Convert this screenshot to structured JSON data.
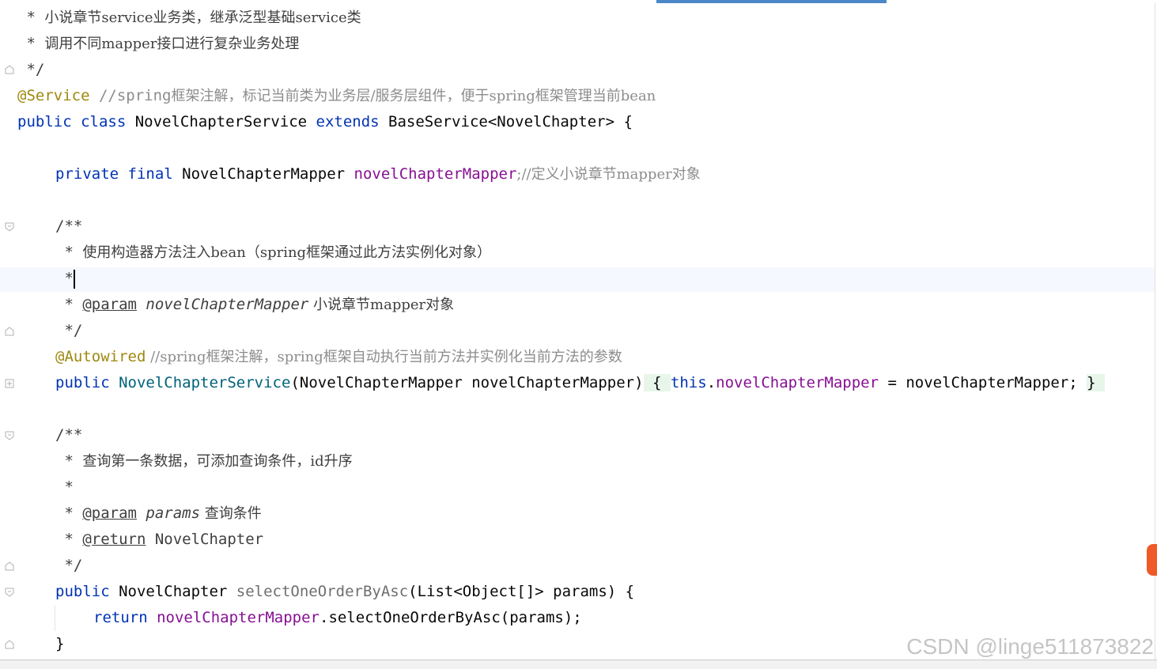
{
  "code_lines": {
    "l1": {
      "prefix": " * ",
      "text": "小说章节service业务类，继承泛型基础service类"
    },
    "l2": {
      "prefix": " * ",
      "text": "调用不同mapper接口进行复杂业务处理"
    },
    "l3": {
      "text": " */"
    },
    "l4": {
      "annotation": "@Service",
      "comment_prefix": " //spring",
      "comment_text": "框架注解，标记当前类为业务层/服务层组件，便于spring框架管理当前bean"
    },
    "l5": {
      "kw1": "public",
      "kw2": "class",
      "class_name": " NovelChapterService ",
      "kw3": "extends",
      "rest": " BaseService<NovelChapter> {"
    },
    "l7": {
      "kw1": "private",
      "kw2": "final",
      "type": " NovelChapterMapper ",
      "field": "novelChapterMapper",
      "comment": ";//定义小说章节mapper对象"
    },
    "l9": {
      "text": "/**"
    },
    "l10": {
      "prefix": " * ",
      "text": "使用构造器方法注入bean（spring框架通过此方法实例化对象）"
    },
    "l11": {
      "text": " *"
    },
    "l12": {
      "prefix": " * ",
      "tag": "@param",
      "param": "novelChapterMapper",
      "text": " 小说章节mapper对象"
    },
    "l13": {
      "text": " */"
    },
    "l14": {
      "annotation": "@Autowired",
      "comment": " //spring框架注解，spring框架自动执行当前方法并实例化当前方法的参数"
    },
    "l15": {
      "kw1": "public",
      "ctor": "NovelChapterService",
      "params": "(NovelChapterMapper novelChapterMapper)",
      "open": "{",
      "kw_this": "this",
      "dot": ".",
      "field": "novelChapterMapper",
      "assign": " = novelChapterMapper; ",
      "close": "}"
    },
    "l17": {
      "text": "/**"
    },
    "l18": {
      "prefix": " * ",
      "text": "查询第一条数据，可添加查询条件，id升序"
    },
    "l19": {
      "text": " *"
    },
    "l20": {
      "prefix": " * ",
      "tag": "@param",
      "param": "params",
      "text": " 查询条件"
    },
    "l21": {
      "prefix": " * ",
      "tag": "@return",
      "text": " NovelChapter"
    },
    "l22": {
      "text": " */"
    },
    "l23": {
      "kw1": "public",
      "type": " NovelChapter ",
      "method": "selectOneOrderByAsc",
      "rest": "(List<Object[]> params) {"
    },
    "l24": {
      "kw_return": "return",
      "field": "novelChapterMapper",
      "rest": ".selectOneOrderByAsc(params);"
    },
    "l25": {
      "text": "}"
    }
  },
  "watermark": "CSDN @linge511873822",
  "colors": {
    "keyword": "#0033b3",
    "annotation": "#9e880d",
    "field": "#871094",
    "constructor": "#00627a",
    "comment": "#8c8c8c",
    "tab_accent": "#4a88c7"
  }
}
